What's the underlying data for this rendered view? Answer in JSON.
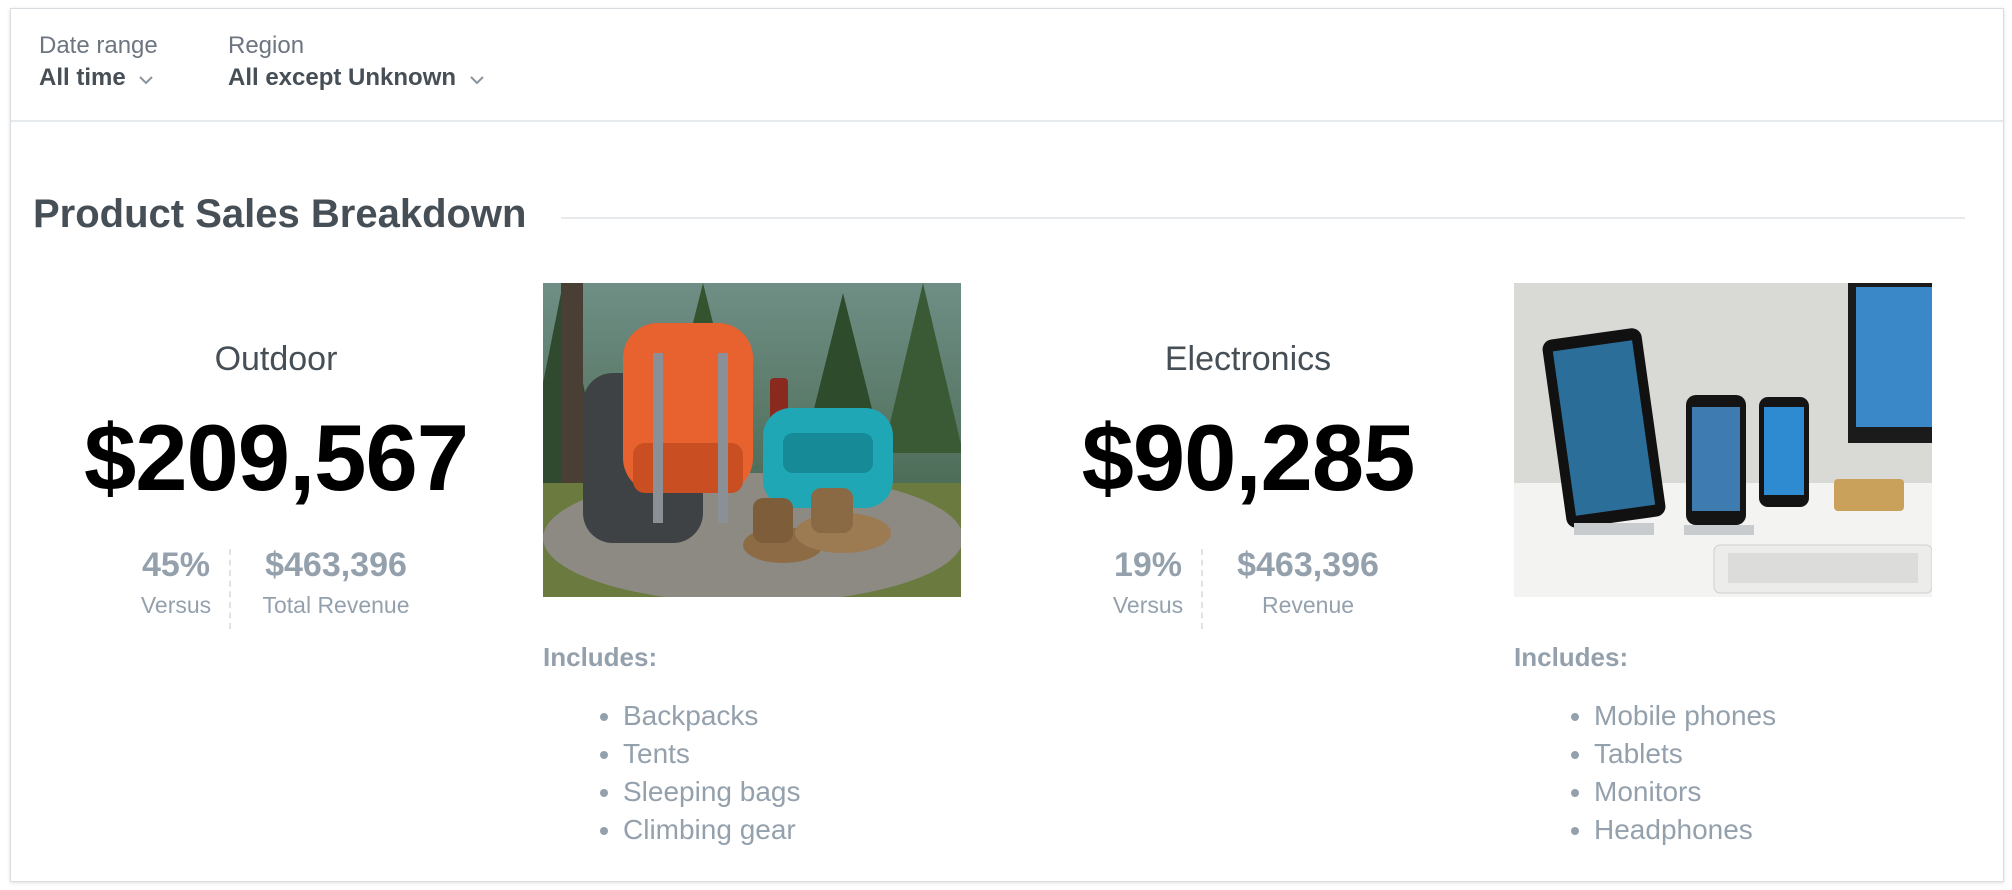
{
  "filters": {
    "date_range": {
      "label": "Date range",
      "value": "All time"
    },
    "region": {
      "label": "Region",
      "value": "All except Unknown"
    }
  },
  "section": {
    "title": "Product Sales Breakdown"
  },
  "kpis": [
    {
      "title": "Outdoor",
      "value": "$209,567",
      "compare": [
        {
          "value": "45%",
          "label": "Versus"
        },
        {
          "value": "$463,396",
          "label": "Total Revenue"
        }
      ]
    },
    {
      "title": "Electronics",
      "value": "$90,285",
      "compare": [
        {
          "value": "19%",
          "label": "Versus"
        },
        {
          "value": "$463,396",
          "label": "Revenue"
        }
      ]
    }
  ],
  "categories": [
    {
      "image": "outdoor-gear-photo",
      "includes_title": "Includes:",
      "items": [
        "Backpacks",
        "Tents",
        "Sleeping bags",
        "Climbing gear"
      ]
    },
    {
      "image": "electronics-devices-photo",
      "includes_title": "Includes:",
      "items": [
        "Mobile phones",
        "Tablets",
        "Monitors",
        "Headphones"
      ]
    }
  ],
  "icons": {
    "dropdown": "chevron-down-icon"
  },
  "colors": {
    "text_dark": "#464e56",
    "text_muted": "#94a1ad",
    "kpi_value": "#000000",
    "divider": "#e6eaed"
  }
}
